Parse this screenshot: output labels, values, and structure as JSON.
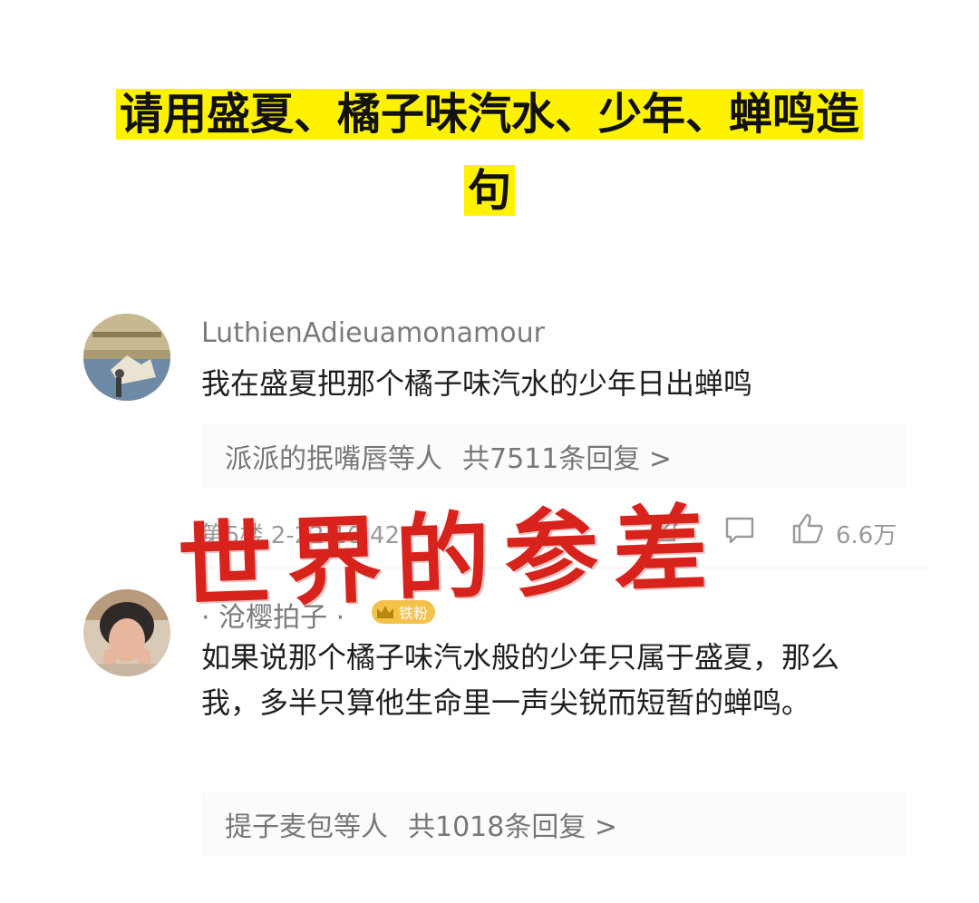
{
  "title": {
    "line1": "请用盛夏、橘子味汽水、少年、蝉鸣造",
    "line2": "句"
  },
  "comments": [
    {
      "username": "LuthienAdieuamonamour",
      "text": "我在盛夏把那个橘子味汽水的少年日出蝉鸣",
      "reply_users": "派派的抿嘴唇等人",
      "reply_count": "共7511条回复 >",
      "floor_time": "第5楼 2-22 16:42",
      "likes": "6.6万"
    },
    {
      "username": "· 沧樱拍子 ·",
      "badge": "铁粉",
      "text": "如果说那个橘子味汽水般的少年只属于盛夏，那么我，多半只算他生命里一声尖锐而短暂的蝉鸣。",
      "reply_users": "提子麦包等人",
      "reply_count": "共1018条回复 >"
    }
  ],
  "overlay_text": "世界的参差",
  "colors": {
    "highlight": "#fff200",
    "overlay": "#d8231c",
    "badge": "#f3c24a"
  }
}
